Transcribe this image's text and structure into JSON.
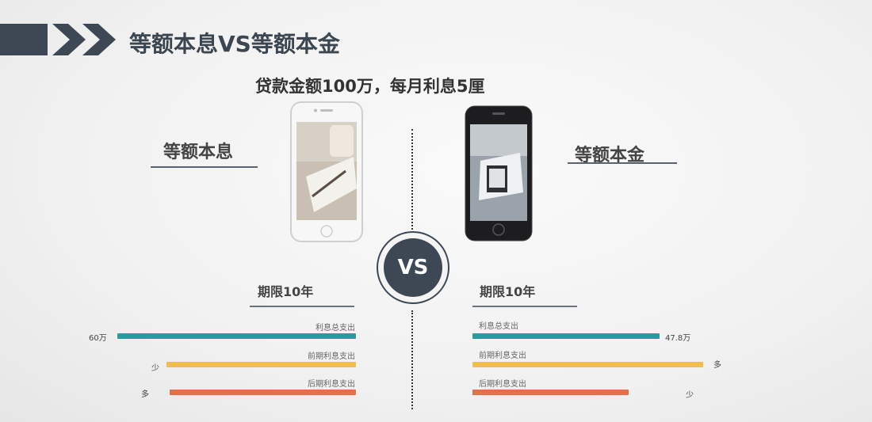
{
  "header": {
    "title": "等额本息VS等额本金"
  },
  "subtitle": "贷款金额100万，每月利息5厘",
  "left": {
    "label": "等额本息",
    "period": "期限10年"
  },
  "right": {
    "label": "等额本金",
    "period": "期限10年"
  },
  "vs_text": "VS",
  "colors": {
    "teal": "#2a9aa0",
    "yellow": "#f1bd4e",
    "orange": "#e2704a",
    "dark": "#3d4854"
  },
  "chart_data": [
    {
      "type": "bar",
      "title": "等额本息",
      "subtitle": "期限10年",
      "bars": [
        {
          "label": "利息总支出",
          "value_text": "60万",
          "value": 60,
          "color": "#2a9aa0"
        },
        {
          "label": "前期利息支出",
          "value_text": "少",
          "level": "少",
          "color": "#f1bd4e"
        },
        {
          "label": "后期利息支出",
          "value_text": "多",
          "level": "多",
          "color": "#e2704a"
        }
      ]
    },
    {
      "type": "bar",
      "title": "等额本金",
      "subtitle": "期限10年",
      "bars": [
        {
          "label": "利息总支出",
          "value_text": "47.8万",
          "value": 47.8,
          "color": "#2a9aa0"
        },
        {
          "label": "前期利息支出",
          "value_text": "多",
          "level": "多",
          "color": "#f1bd4e"
        },
        {
          "label": "后期利息支出",
          "value_text": "少",
          "level": "少",
          "color": "#e2704a"
        }
      ]
    }
  ]
}
